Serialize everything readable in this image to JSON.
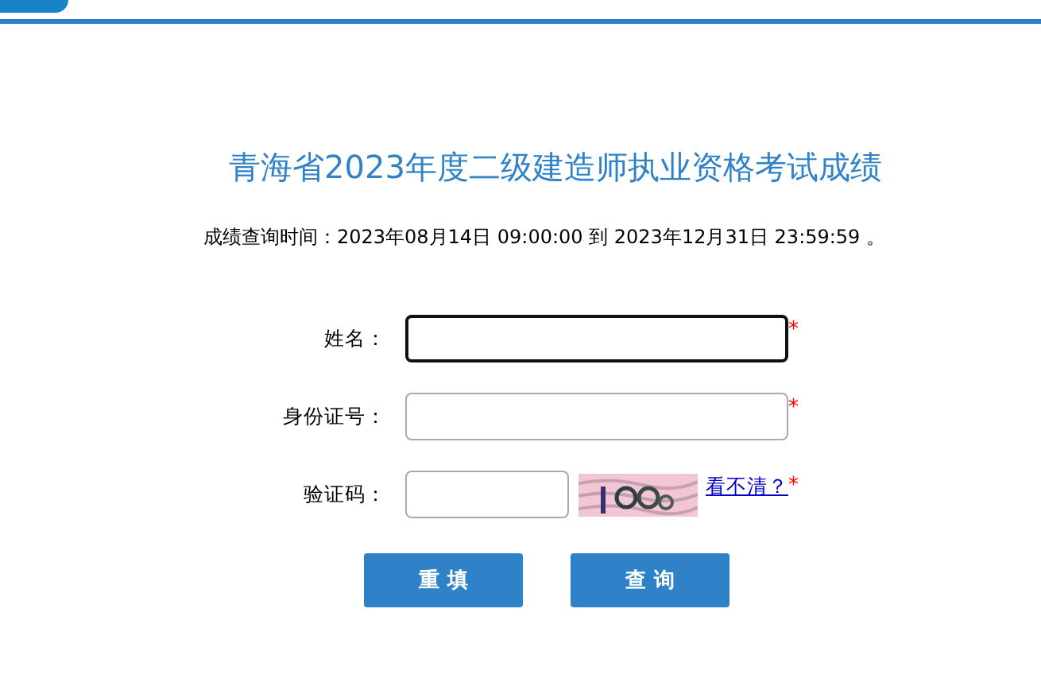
{
  "title": "青海省2023年度二级建造师执业资格考试成绩",
  "query_time": "成绩查询时间：2023年08月14日 09:00:00 到 2023年12月31日 23:59:59 。",
  "fields": [
    {
      "kind": "text",
      "label": "姓名：",
      "focused": true,
      "required_mark": "*"
    },
    {
      "kind": "text",
      "label": "身份证号：",
      "focused": false,
      "required_mark": "*"
    },
    {
      "kind": "captcha",
      "label": "验证码：",
      "focused": false,
      "refresh_link": "看不清？",
      "required_mark": "*"
    }
  ],
  "buttons": [
    "重 填",
    "查 询"
  ]
}
